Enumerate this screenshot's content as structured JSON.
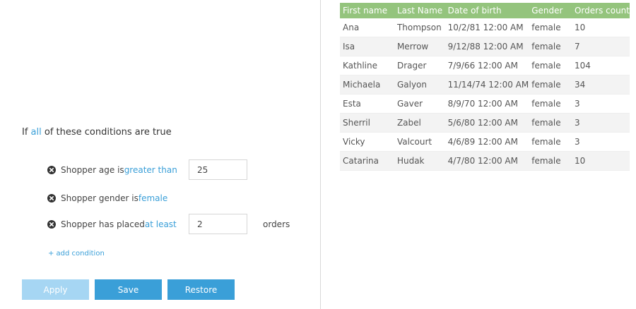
{
  "conditions": {
    "header_prefix": "If ",
    "header_quantifier": "all",
    "header_suffix": " of these conditions are true",
    "rows": [
      {
        "text": "Shopper age is ",
        "operator": "greater than",
        "value": "25",
        "suffix": ""
      },
      {
        "text": "Shopper gender is ",
        "operator": "female",
        "value": "",
        "suffix": ""
      },
      {
        "text": "Shopper has placed ",
        "operator": "at least",
        "value": "2",
        "suffix": "orders"
      }
    ],
    "add_label": "+ add condition"
  },
  "buttons": {
    "apply": "Apply",
    "save": "Save",
    "restore": "Restore"
  },
  "colors": {
    "accent": "#3a9fd8",
    "accent_disabled": "#a6d6f3",
    "table_header": "#94c47d"
  },
  "icons": {
    "remove": "circle-x-icon"
  },
  "table": {
    "columns": [
      "First name",
      "Last Name",
      "Date of birth",
      "Gender",
      "Orders count"
    ],
    "rows": [
      [
        "Ana",
        "Thompson",
        "10/2/81 12:00 AM",
        "female",
        "10"
      ],
      [
        "Isa",
        "Merrow",
        "9/12/88 12:00 AM",
        "female",
        "7"
      ],
      [
        "Kathline",
        "Drager",
        "7/9/66 12:00 AM",
        "female",
        "104"
      ],
      [
        "Michaela",
        "Galyon",
        "11/14/74 12:00 AM",
        "female",
        "34"
      ],
      [
        "Esta",
        "Gaver",
        "8/9/70 12:00 AM",
        "female",
        "3"
      ],
      [
        "Sherril",
        "Zabel",
        "5/6/80 12:00 AM",
        "female",
        "3"
      ],
      [
        "Vicky",
        "Valcourt",
        "4/6/89 12:00 AM",
        "female",
        "3"
      ],
      [
        "Catarina",
        "Hudak",
        "4/7/80 12:00 AM",
        "female",
        "10"
      ]
    ]
  }
}
